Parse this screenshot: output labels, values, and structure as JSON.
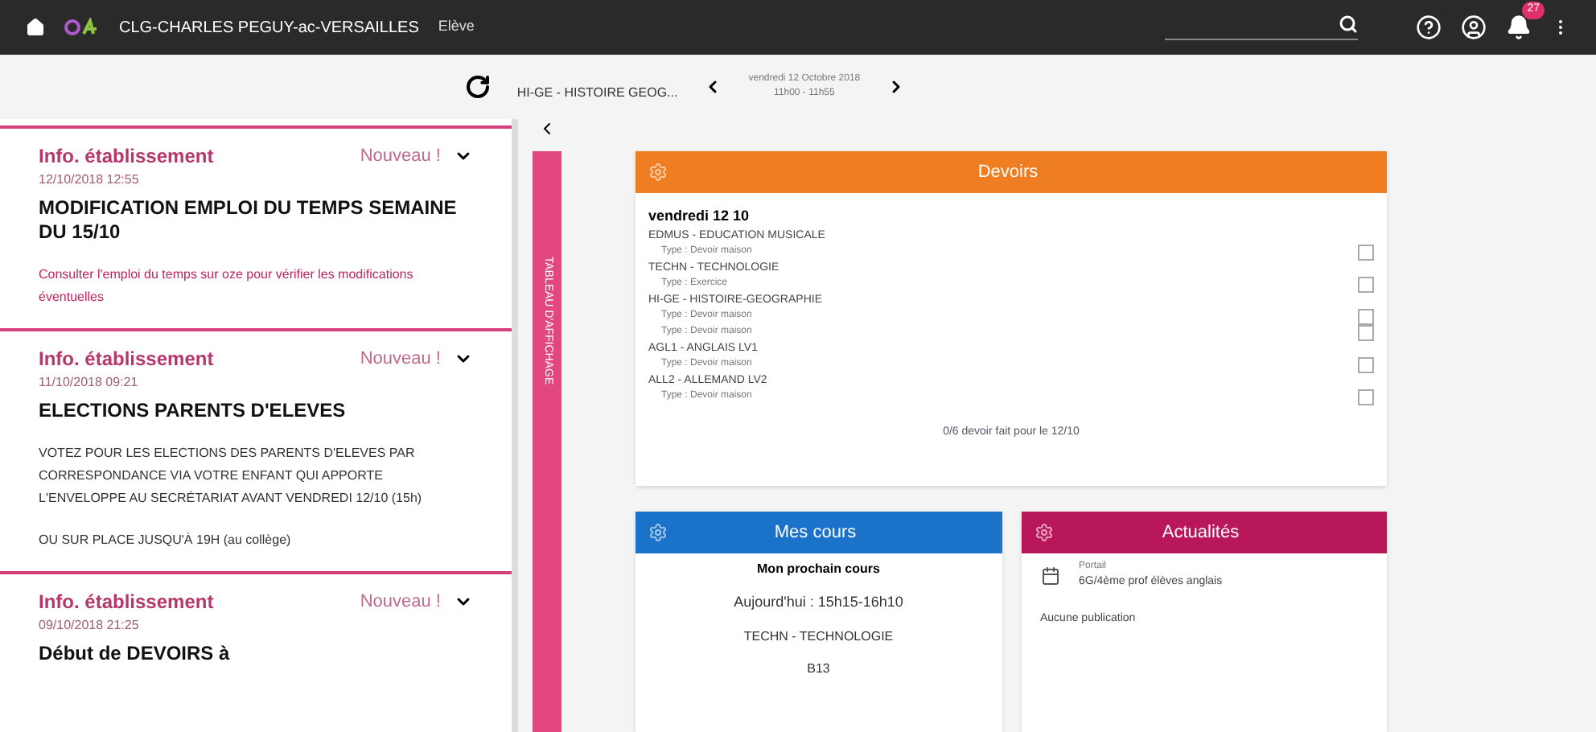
{
  "topbar": {
    "school": "CLG-CHARLES PEGUY-ac-VERSAILLES",
    "role": "Elève",
    "notifications": "27"
  },
  "course_nav": {
    "course": "HI-GE - HISTOIRE GEOG...",
    "date": "vendredi 12 Octobre 2018",
    "time": "11h00 - 11h55"
  },
  "posts": [
    {
      "category": "Info. établissement",
      "badge": "Nouveau !",
      "date": "12/10/2018 12:55",
      "title": "MODIFICATION EMPLOI DU TEMPS SEMAINE DU 15/10",
      "body": [
        {
          "kind": "link",
          "text": "Consulter l'emploi du temps sur oze pour vérifier les modifications éventuelles"
        }
      ]
    },
    {
      "category": "Info. établissement",
      "badge": "Nouveau !",
      "date": "11/10/2018 09:21",
      "title": "ELECTIONS PARENTS D'ELEVES",
      "body": [
        {
          "kind": "plain",
          "text": "VOTEZ POUR LES ELECTIONS DES PARENTS D'ELEVES PAR CORRESPONDANCE VIA VOTRE ENFANT QUI APPORTE L'ENVELOPPE AU SECRÉTARIAT AVANT VENDREDI 12/10 (15h)"
        },
        {
          "kind": "plain",
          "text": "OU SUR PLACE JUSQU'À 19H (au collège)"
        }
      ]
    },
    {
      "category": "Info. établissement",
      "badge": "Nouveau !",
      "date": "09/10/2018 21:25",
      "title": "Début de DEVOIRS à"
    }
  ],
  "side_tab": "TABLEAU D'AFFICHAGE",
  "devoirs": {
    "title": "Devoirs",
    "day": "vendredi 12 10",
    "subjects": [
      {
        "name": "EDMUS - EDUCATION MUSICALE",
        "tasks": [
          {
            "type": "Type : Devoir maison",
            "done": false
          }
        ]
      },
      {
        "name": "TECHN - TECHNOLOGIE",
        "tasks": [
          {
            "type": "Type : Exercice",
            "done": false
          }
        ]
      },
      {
        "name": "HI-GE - HISTOIRE-GEOGRAPHIE",
        "tasks": [
          {
            "type": "Type : Devoir maison",
            "done": false
          },
          {
            "type": "Type : Devoir maison",
            "done": false
          }
        ]
      },
      {
        "name": "AGL1 - ANGLAIS LV1",
        "tasks": [
          {
            "type": "Type : Devoir maison",
            "done": false
          }
        ]
      },
      {
        "name": "ALL2 - ALLEMAND LV2",
        "tasks": [
          {
            "type": "Type : Devoir maison",
            "done": false
          }
        ]
      }
    ],
    "summary": "0/6 devoir fait pour le 12/10"
  },
  "cours": {
    "title": "Mes cours",
    "heading": "Mon prochain cours",
    "when": "Aujourd'hui : 15h15-16h10",
    "subject": "TECHN - TECHNOLOGIE",
    "room": "B13"
  },
  "actualites": {
    "title": "Actualités",
    "source": "Portail",
    "group": "6G/4ème prof élèves anglais",
    "empty": "Aucune publication"
  }
}
